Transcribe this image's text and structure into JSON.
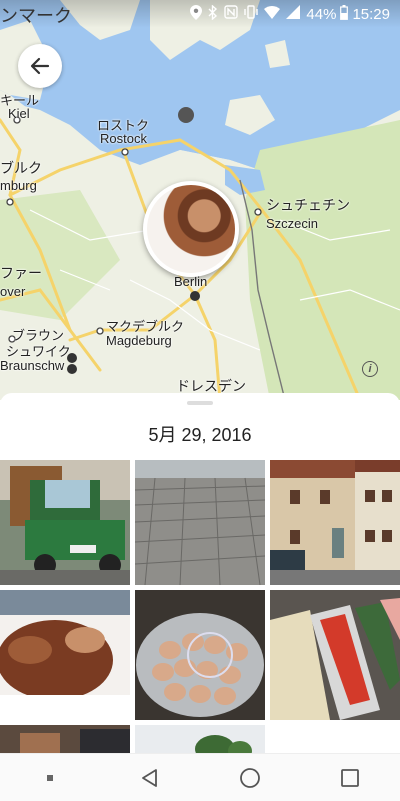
{
  "status_bar": {
    "left_text": "ンマーク",
    "battery": "44%",
    "time": "15:29",
    "icons": [
      "location-icon",
      "bluetooth-icon",
      "nfc-icon",
      "vibrate-icon",
      "wifi-icon",
      "signal-icon",
      "battery-icon"
    ]
  },
  "map": {
    "labels": {
      "kiel_jp": "キール",
      "kiel": "Kiel",
      "rostock_jp": "ロストク",
      "rostock": "Rostock",
      "hamburg_jp": "ブルク",
      "hamburg": "mburg",
      "szczecin_jp": "シュチェチン",
      "szczecin": "Szczecin",
      "hannover_jp": "ファー",
      "hannover": "over",
      "berlin": "Berlin",
      "braunschweig_jp1": "ブラウン",
      "braunschweig_jp2": "シュワイク",
      "braunschweig": "Braunschw",
      "magdeburg_jp": "マクデブルク",
      "magdeburg": "Magdeburg",
      "dresden_jp": "ドレスデン"
    },
    "colors": {
      "water": "#9fc6f0",
      "land": "#eef0e4",
      "green": "#cfe3b0",
      "road": "#f5d36a"
    }
  },
  "sheet": {
    "date": "5月 29, 2016"
  },
  "photos": [
    {
      "name": "green-van-photo"
    },
    {
      "name": "cobblestone-photo"
    },
    {
      "name": "half-timbered-house-photo"
    },
    {
      "name": "cake-photo"
    },
    {
      "name": "eggs-photo"
    },
    {
      "name": "buffet-photo"
    },
    {
      "name": "bottom-left-photo"
    },
    {
      "name": "bottom-middle-photo"
    }
  ]
}
